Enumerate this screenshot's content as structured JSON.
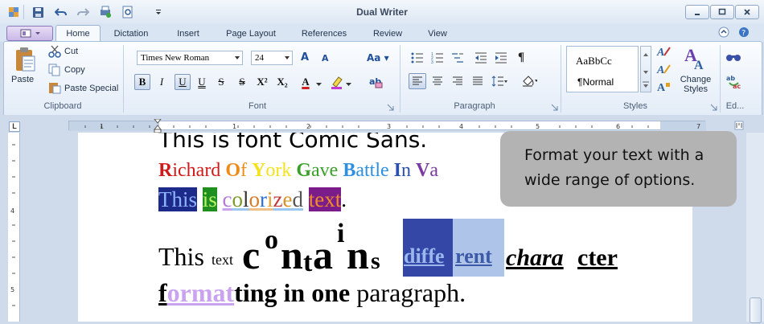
{
  "app": {
    "title": "Dual Writer"
  },
  "tabs": [
    "Home",
    "Dictation",
    "Insert",
    "Page Layout",
    "References",
    "Review",
    "View"
  ],
  "clipboard": {
    "paste": "Paste",
    "cut": "Cut",
    "copy": "Copy",
    "paste_special": "Paste Special",
    "group": "Clipboard"
  },
  "font": {
    "family": "Times New Roman",
    "size": "24",
    "group": "Font",
    "grow_glyph": "A",
    "shrink_glyph": "A",
    "case_glyph": "Aa",
    "buttons": [
      "B",
      "I",
      "U",
      "U",
      "S",
      "S",
      "X²",
      "X₂",
      "A"
    ]
  },
  "paragraph": {
    "group": "Paragraph",
    "pilcrow": "¶"
  },
  "styles": {
    "preview": "AaBbCc",
    "current": "¶Normal",
    "change": "Change Styles",
    "group": "Styles"
  },
  "editing": {
    "group": "Ed..."
  },
  "document": {
    "line1": "This is font Comic Sans.",
    "rainbow": [
      "R",
      "ichard ",
      "O",
      "f ",
      "Y",
      "ork ",
      "G",
      "ave ",
      "B",
      "attle ",
      "I",
      "n ",
      "V",
      "a"
    ],
    "colorized": {
      "w1": "This",
      "w2": "is",
      "w3_chars": [
        "c",
        "o",
        "l",
        "o",
        "r",
        "i",
        "z",
        "e",
        "d"
      ],
      "w4": "text",
      "period": "."
    },
    "line4": {
      "a": "This",
      "b": "text",
      "c": "c",
      "d": "o",
      "e": "n",
      "f": "t",
      "g": "a",
      "h": "i",
      "i": "n",
      "j": "s",
      "k": "diffe",
      "l": "rent",
      "m": "chara",
      "n": "cter"
    },
    "line5": {
      "a": "f",
      "b": "ormat",
      "c": "ting in one",
      "d": " paragraph."
    }
  },
  "tooltip": {
    "text": "Format your text with a wide range of options."
  },
  "colors": {
    "accent": "#3a4fa8",
    "callout": "#b3b3b3",
    "ribbon_border": "#a9bfdb"
  }
}
